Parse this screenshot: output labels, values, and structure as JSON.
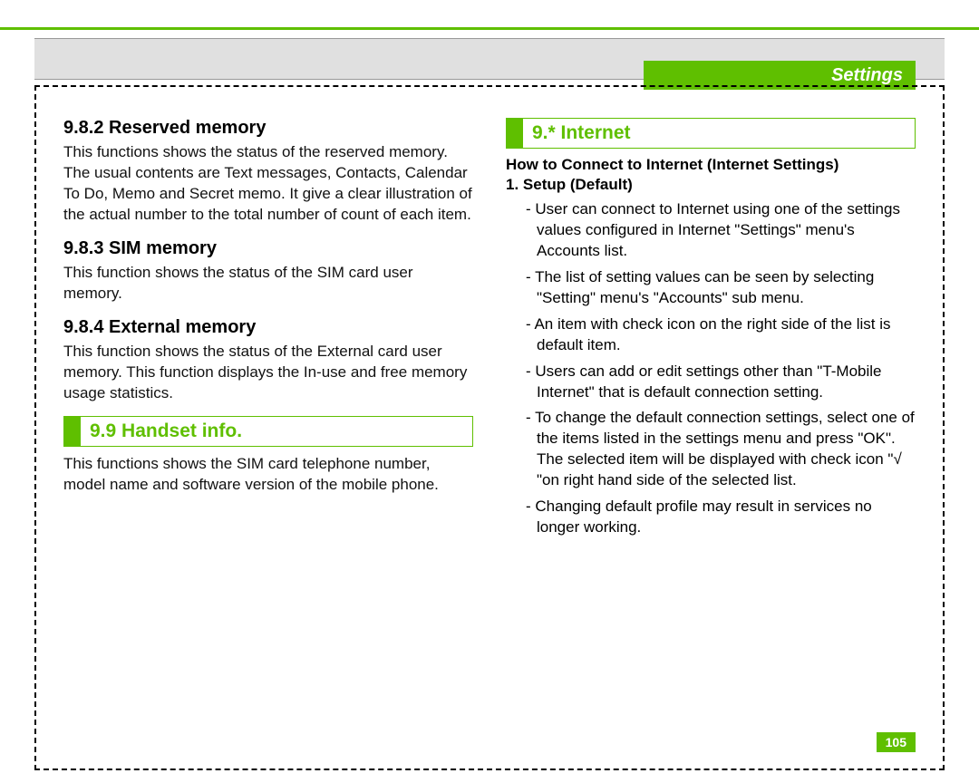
{
  "header": {
    "tab": "Settings"
  },
  "left": {
    "s1": {
      "heading": "9.8.2 Reserved memory",
      "body": "This functions shows the status of the reserved memory. The usual contents are Text messages, Contacts, Calendar To Do, Memo and Secret memo. It give a clear illustration of the actual number to the total number of count of each item."
    },
    "s2": {
      "heading": "9.8.3 SIM memory",
      "body": "This function shows the status of the SIM card user memory."
    },
    "s3": {
      "heading": "9.8.4 External memory",
      "body": "This function shows the status of the External card user memory. This function displays the In-use and free memory usage statistics."
    },
    "sec": {
      "label": "9.9 Handset info."
    },
    "s4": {
      "body": "This functions shows the SIM card telephone number, model name and software version of the mobile phone."
    }
  },
  "right": {
    "sec": {
      "label": "9.* Internet"
    },
    "intro1": "How to Connect to Internet (Internet Settings)",
    "intro2": "1. Setup (Default)",
    "items": {
      "i0": "- User can connect to Internet using one of the settings values configured in Internet \"Settings\" menu's Accounts list.",
      "i1": "- The list of setting values can be seen by selecting \"Setting\" menu's \"Accounts\" sub menu.",
      "i2": "- An item with check icon on the right side of the list is default item.",
      "i3": "- Users can add or edit settings other than \"T-Mobile Internet\" that is default connection setting.",
      "i4": "- To change the default connection settings, select one of the items listed in the settings menu and press \"OK\". The selected item will be displayed with check icon \"√ \"on right hand side of the selected list.",
      "i5": "- Changing default profile may result in services no longer working."
    }
  },
  "page_number": "105"
}
